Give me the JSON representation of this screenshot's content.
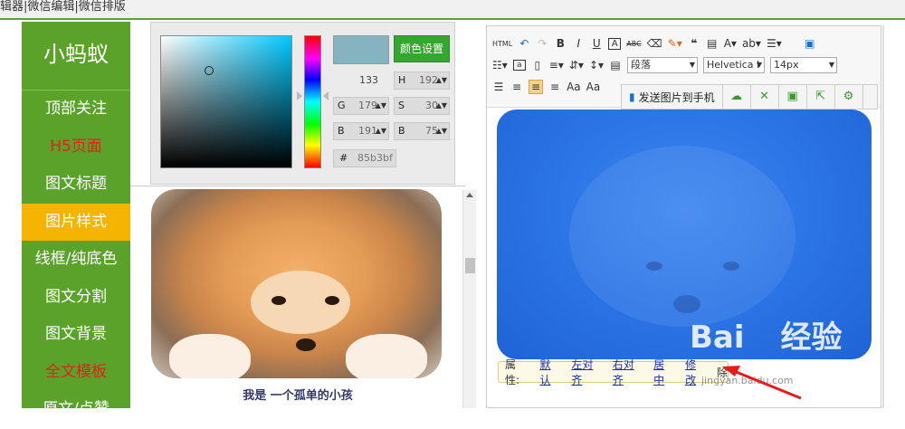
{
  "topbar": {
    "text": "辑器|微信编辑|微信排版"
  },
  "sidebar": {
    "brand": "小蚂蚁",
    "items": [
      {
        "label": "顶部关注",
        "color": "white"
      },
      {
        "label": "H5页面",
        "color": "red"
      },
      {
        "label": "图文标题",
        "color": "white"
      },
      {
        "label": "图片样式",
        "color": "white",
        "active": true
      },
      {
        "label": "线框/纯底色",
        "color": "white"
      },
      {
        "label": "图文分割",
        "color": "white"
      },
      {
        "label": "图文背景",
        "color": "white"
      },
      {
        "label": "全文模板",
        "color": "red"
      },
      {
        "label": "原文/点赞",
        "color": "white"
      }
    ]
  },
  "colors": {
    "sidebar_green": "#5aa22a",
    "active_yellow": "#f5b400",
    "picked": "#85b3bf",
    "editor_blue": "#2b74e6"
  },
  "picker": {
    "set_button": "颜色设置",
    "value_133": "133",
    "h_label": "H",
    "h_value": "192",
    "g_label": "G",
    "g_value": "179",
    "s_label": "S",
    "s_value": "30",
    "b_label": "B",
    "b_value": "191",
    "b2_label": "B",
    "b2_value": "75",
    "hex_label": "#",
    "hex_value": "85b3bf"
  },
  "preview": {
    "caption": "我是 一个孤单的小孩"
  },
  "editor": {
    "toolbar": {
      "paragraph": "段落",
      "font": "Helvetica I",
      "size": "14px"
    },
    "popup": {
      "send": "发送图片到手机"
    },
    "propbar": {
      "label": "属性:",
      "default": "默认",
      "left": "左对齐",
      "right": "右对齐",
      "center": "居中",
      "edit": "修改",
      "extra": "除"
    }
  },
  "watermark": {
    "text": "Bai度经验",
    "sub": "jingyan.baidu.com"
  }
}
